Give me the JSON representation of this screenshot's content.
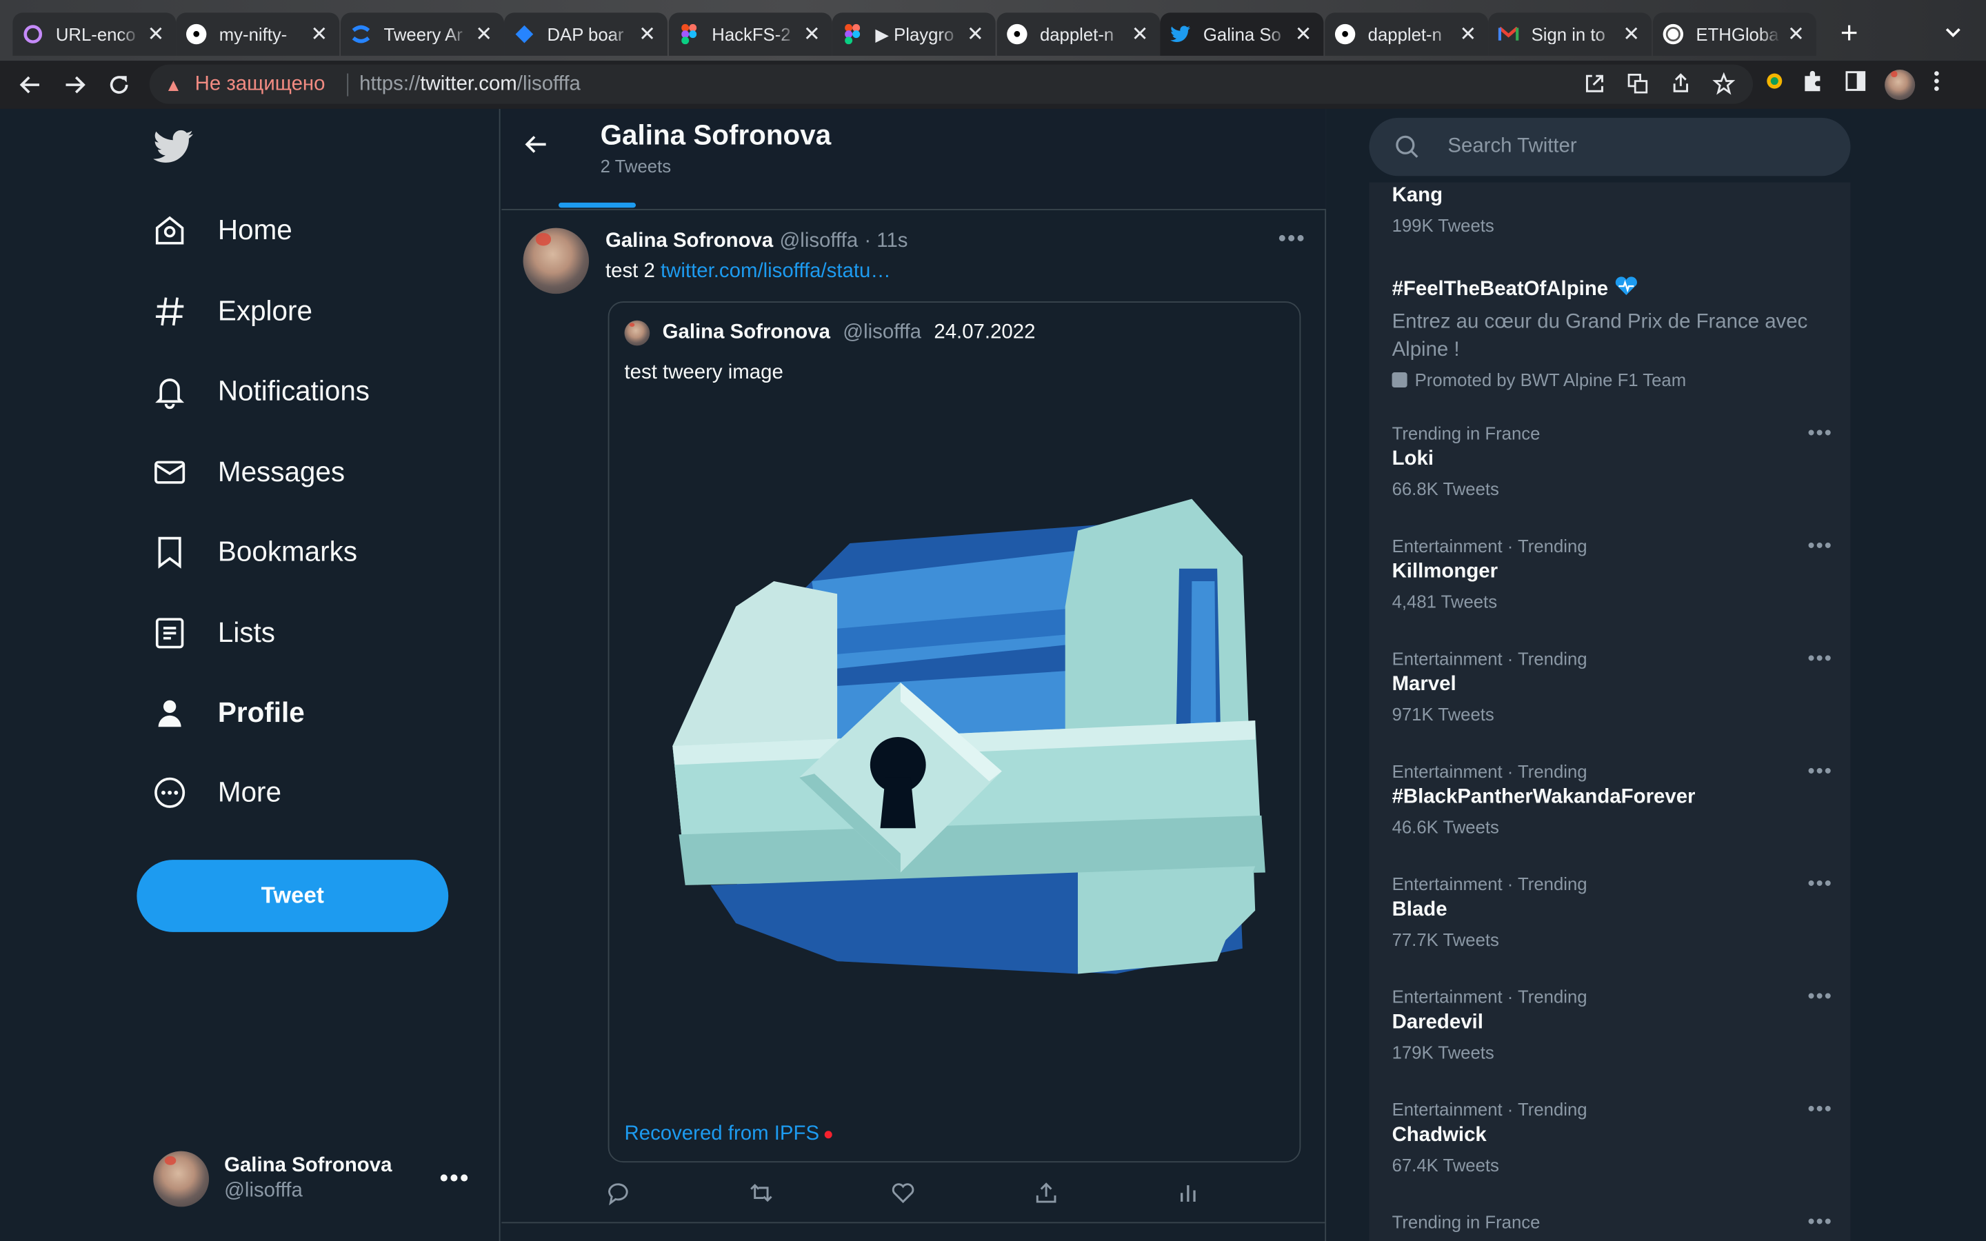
{
  "browser": {
    "tabs": [
      {
        "title": "URL-enco",
        "icon": "circle-icon",
        "active": false
      },
      {
        "title": "my-nifty-",
        "icon": "github-icon",
        "active": false
      },
      {
        "title": "Tweery Ar",
        "icon": "confluence-icon",
        "active": false
      },
      {
        "title": "DAP boar",
        "icon": "jira-icon",
        "active": false
      },
      {
        "title": "HackFS-2",
        "icon": "figma-icon",
        "active": false
      },
      {
        "title": "▶ Playgro",
        "icon": "figma-icon",
        "active": false
      },
      {
        "title": "dapplet-n",
        "icon": "github-icon",
        "active": false
      },
      {
        "title": "Galina So",
        "icon": "twitter-icon",
        "active": true
      },
      {
        "title": "dapplet-n",
        "icon": "github-icon",
        "active": false
      },
      {
        "title": "Sign in to",
        "icon": "gmail-icon",
        "active": false
      },
      {
        "title": "ETHGloba",
        "icon": "globe-icon",
        "active": false
      }
    ],
    "insecure_label": "Не защищено",
    "url_scheme": "https://",
    "url_host": "twitter.com",
    "url_path": "/lisofffa"
  },
  "nav": {
    "items": [
      {
        "label": "Home",
        "icon": "home-icon"
      },
      {
        "label": "Explore",
        "icon": "hashtag-icon"
      },
      {
        "label": "Notifications",
        "icon": "bell-icon"
      },
      {
        "label": "Messages",
        "icon": "envelope-icon"
      },
      {
        "label": "Bookmarks",
        "icon": "bookmark-icon"
      },
      {
        "label": "Lists",
        "icon": "list-icon"
      },
      {
        "label": "Profile",
        "icon": "person-icon"
      },
      {
        "label": "More",
        "icon": "more-circle-icon"
      }
    ],
    "tweet_button": "Tweet",
    "account": {
      "name": "Galina Sofronova",
      "handle": "@lisofffa"
    }
  },
  "profile_header": {
    "name": "Galina Sofronova",
    "tweet_count": "2 Tweets"
  },
  "tweet": {
    "name": "Galina Sofronova",
    "handle": "@lisofffa",
    "time": "· 11s",
    "text": "test 2 ",
    "link": "twitter.com/lisofffa/statu…",
    "quote": {
      "name": "Galina Sofronova",
      "handle": "@lisofffa",
      "date": "24.07.2022",
      "text": "test tweery image",
      "footer": "Recovered from IPFS"
    }
  },
  "search": {
    "placeholder": "Search Twitter"
  },
  "trends": [
    {
      "meta": "",
      "name": "Kang",
      "count": "199K Tweets"
    },
    {
      "meta": "",
      "name": "#FeelTheBeatOfAlpine",
      "desc": "Entrez au cœur du Grand Prix de France avec Alpine !",
      "promoted": "Promoted by BWT Alpine F1 Team"
    },
    {
      "meta": "Trending in France",
      "name": "Loki",
      "count": "66.8K Tweets"
    },
    {
      "meta": "Entertainment · Trending",
      "name": "Killmonger",
      "count": "4,481 Tweets"
    },
    {
      "meta": "Entertainment · Trending",
      "name": "Marvel",
      "count": "971K Tweets"
    },
    {
      "meta": "Entertainment · Trending",
      "name": "#BlackPantherWakandaForever",
      "count": "46.6K Tweets"
    },
    {
      "meta": "Entertainment · Trending",
      "name": "Blade",
      "count": "77.7K Tweets"
    },
    {
      "meta": "Entertainment · Trending",
      "name": "Daredevil",
      "count": "179K Tweets"
    },
    {
      "meta": "Entertainment · Trending",
      "name": "Chadwick",
      "count": "67.4K Tweets"
    },
    {
      "meta": "Trending in France",
      "name": "",
      "count": ""
    }
  ],
  "colors": {
    "accent": "#1d9bf0",
    "background": "#15202b",
    "border": "#38444d"
  }
}
